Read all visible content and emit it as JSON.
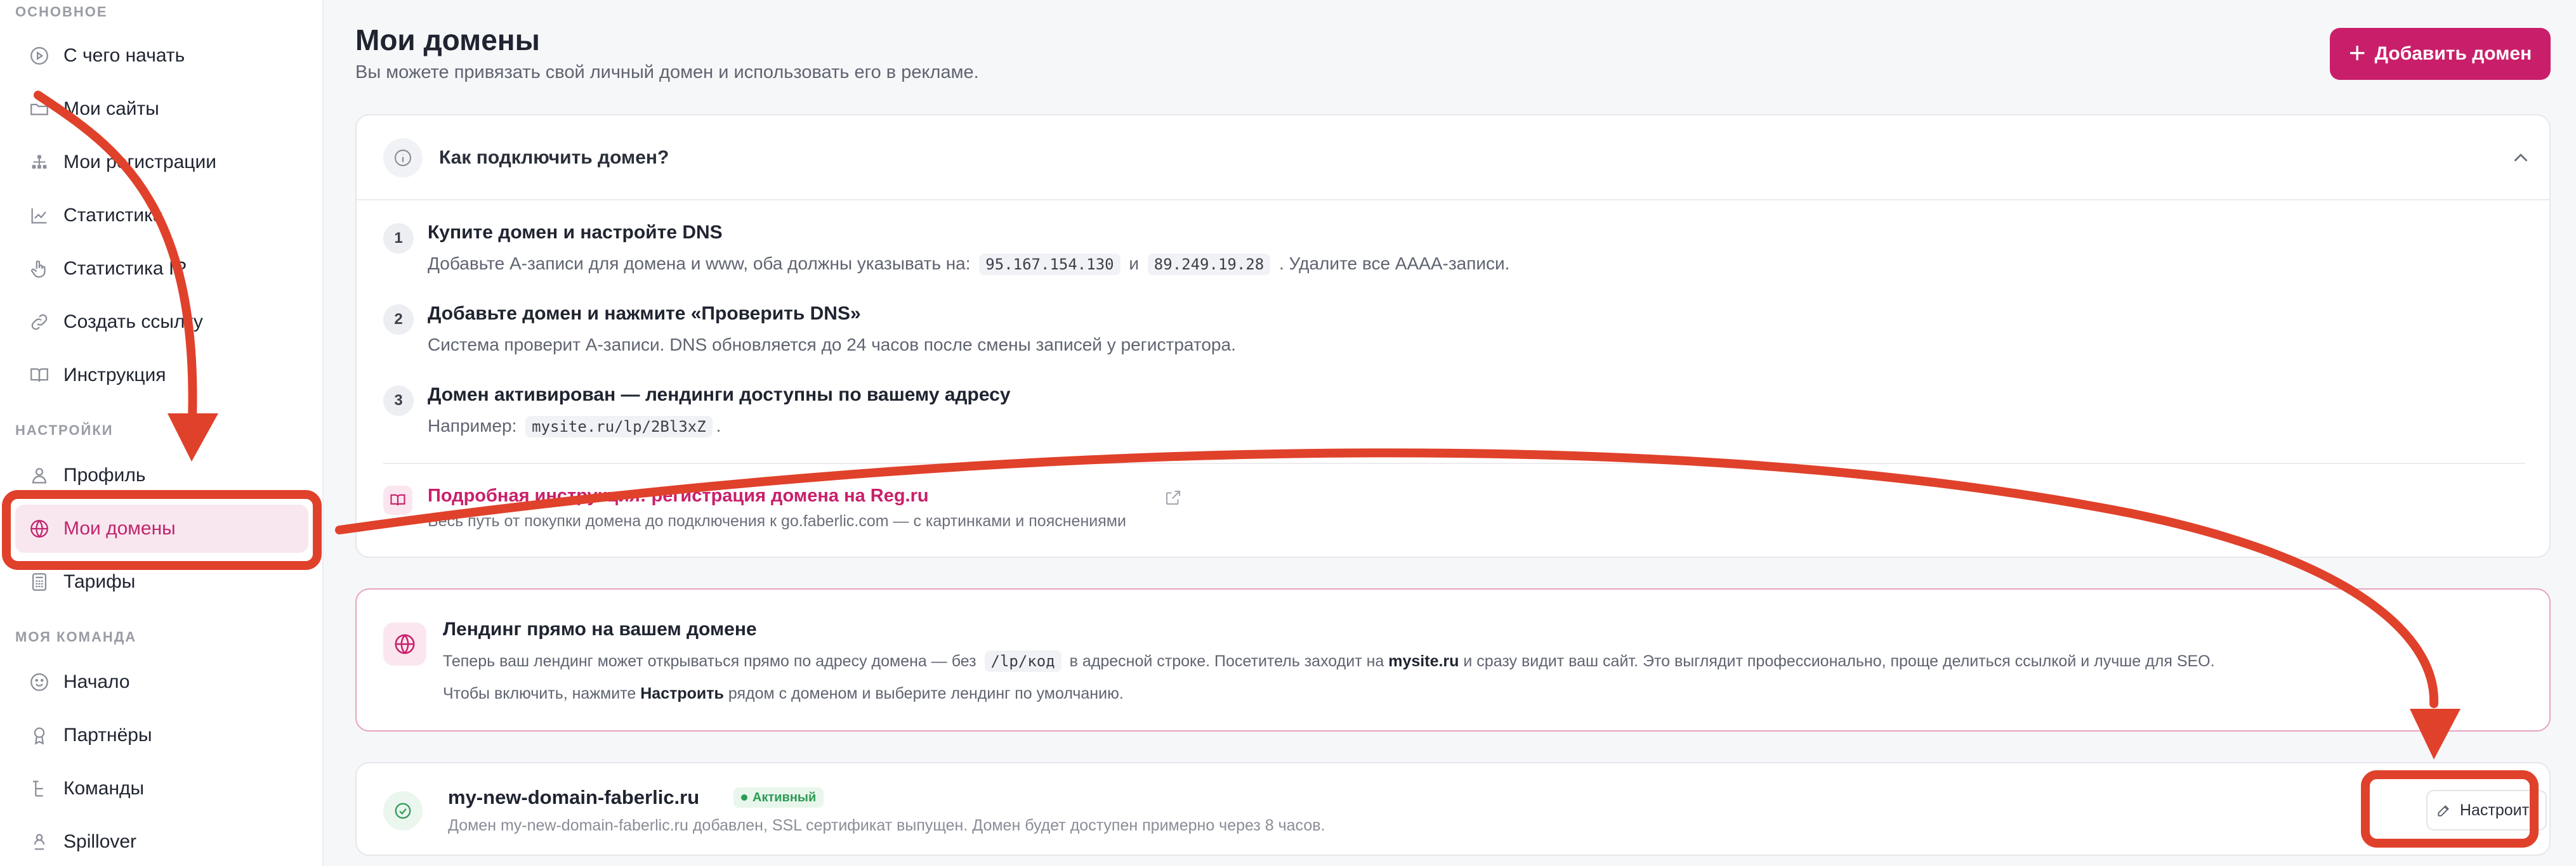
{
  "sidebar": {
    "sections": [
      {
        "title": "ОСНОВНОЕ"
      },
      {
        "title": "НАСТРОЙКИ"
      },
      {
        "title": "МОЯ КОМАНДА"
      }
    ],
    "items": [
      {
        "label": "С чего начать",
        "icon": "play-circle-icon"
      },
      {
        "label": "Мои сайты",
        "icon": "folder-icon"
      },
      {
        "label": "Мои регистрации",
        "icon": "hierarchy-icon"
      },
      {
        "label": "Статистика",
        "icon": "line-chart-icon"
      },
      {
        "label": "Статистика IP",
        "icon": "hand-pointer-icon"
      },
      {
        "label": "Создать ссылку",
        "icon": "link-icon"
      },
      {
        "label": "Инструкция",
        "icon": "book-icon"
      },
      {
        "label": "Профиль",
        "icon": "user-icon"
      },
      {
        "label": "Мои домены",
        "icon": "globe-icon",
        "active": true
      },
      {
        "label": "Тарифы",
        "icon": "calculator-icon"
      },
      {
        "label": "Начало",
        "icon": "smile-icon"
      },
      {
        "label": "Партнёры",
        "icon": "award-icon"
      },
      {
        "label": "Команды",
        "icon": "tree-icon"
      },
      {
        "label": "Spillover",
        "icon": "user-stack-icon"
      }
    ]
  },
  "header": {
    "title": "Мои домены",
    "subtitle": "Вы можете привязать свой личный домен и использовать его в рекламе.",
    "add_button": "Добавить домен"
  },
  "howto": {
    "title": "Как подключить домен?",
    "steps": [
      {
        "num": "1",
        "title": "Купите домен и настройте DNS",
        "text_a": "Добавьте A-записи для домена и www, оба должны указывать на:",
        "ip1": "95.167.154.130",
        "and": "и",
        "ip2": "89.249.19.28",
        "text_b": ". Удалите все AAAA-записи."
      },
      {
        "num": "2",
        "title": "Добавьте домен и нажмите «Проверить DNS»",
        "text": "Система проверит A-записи. DNS обновляется до 24 часов после смены записей у регистратора."
      },
      {
        "num": "3",
        "title": "Домен активирован — лендинги доступны по вашему адресу",
        "text_a": "Например:",
        "example": "mysite.ru/lp/2Bl3xZ",
        "text_b": "."
      }
    ],
    "guide_link": "Подробная инструкция: регистрация домена на Reg.ru",
    "guide_sub": "Весь путь от покупки домена до подключения к go.faberlic.com — с картинками и пояснениями"
  },
  "landing": {
    "title": "Лендинг прямо на вашем домене",
    "text_a": "Теперь ваш лендинг может открываться прямо по адресу домена — без",
    "code": "/lp/код",
    "text_b": "в адресной строке. Посетитель заходит на",
    "site": "mysite.ru",
    "text_c": "и сразу видит ваш сайт. Это выглядит профессионально, проще делиться ссылкой и лучше для SEO.",
    "hint_a": "Чтобы включить, нажмите",
    "hint_bold": "Настроить",
    "hint_b": "рядом с доменом и выберите лендинг по умолчанию."
  },
  "domains": [
    {
      "name": "my-new-domain-faberlic.ru",
      "status": "Активный",
      "description": "Домен my-new-domain-faberlic.ru добавлен, SSL сертификат выпущен. Домен будет доступен примерно через 8 часов.",
      "action": "Настроить"
    }
  ],
  "colors": {
    "accent": "#c91f6a",
    "active_bg": "#f8e7ef",
    "success": "#2e9b55",
    "annotation": "#e0412b"
  }
}
